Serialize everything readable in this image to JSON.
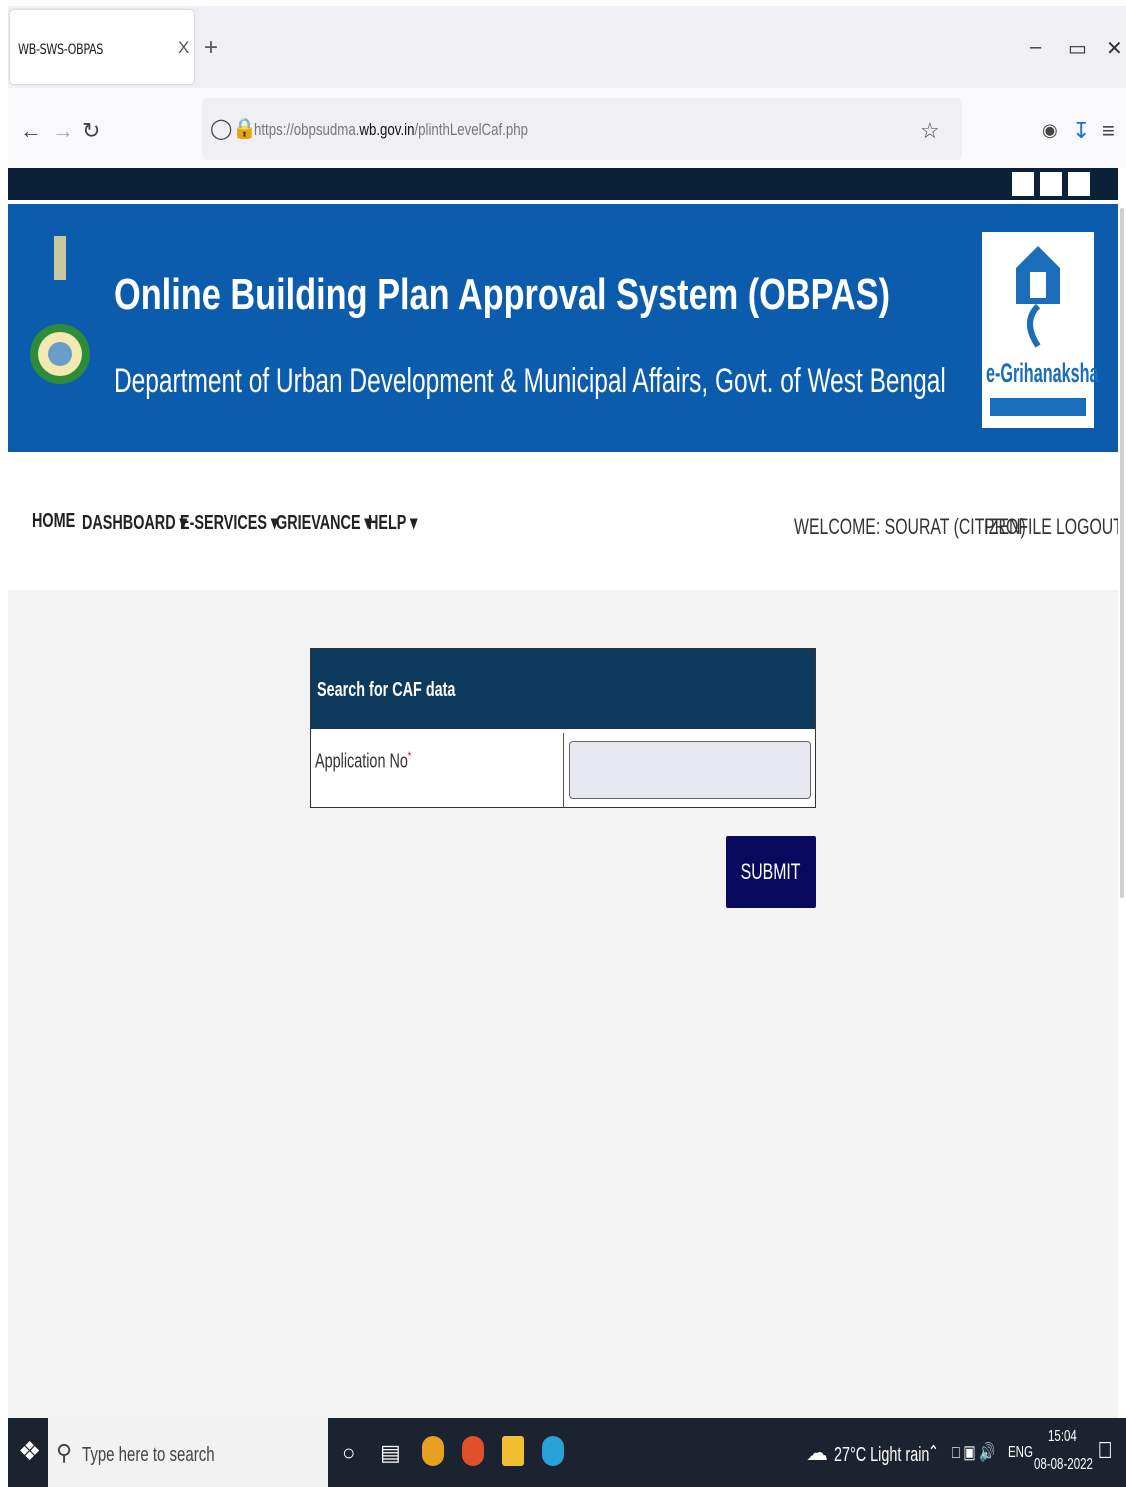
{
  "browser": {
    "tab_title": "WB-SWS-OBPAS",
    "tab_close": "X",
    "new_tab": "+",
    "url_prefix": "https://obpsudma.",
    "url_domain": "wb.gov.in",
    "url_path": "/plinthLevelCaf.php"
  },
  "banner": {
    "title": "Online Building Plan Approval System (OBPAS)",
    "subtitle": "Department of Urban Development & Municipal Affairs, Govt. of West Bengal",
    "logo_text": "e-Grihanaksha"
  },
  "menu": {
    "items": [
      "HOME",
      "DASHBOARD",
      "E-SERVICES",
      "GRIEVANCE",
      "HELP"
    ],
    "welcome": "WELCOME: SOURAT (CITIZEN)",
    "profile": "PROFILE",
    "logout": "LOGOUT"
  },
  "form": {
    "title": "Search for CAF data",
    "application_label": "Application No",
    "required_mark": "*",
    "application_value": "",
    "submit_label": "SUBMIT"
  },
  "taskbar": {
    "search_placeholder": "Type here to search",
    "weather": "27°C  Light rain",
    "language": "ENG",
    "time": "15:04",
    "date": "08-08-2022"
  },
  "colors": {
    "banner": "#0b5cad",
    "dark_strip": "#0a2138",
    "panel_header": "#0d3a5c",
    "submit": "#08085e"
  }
}
